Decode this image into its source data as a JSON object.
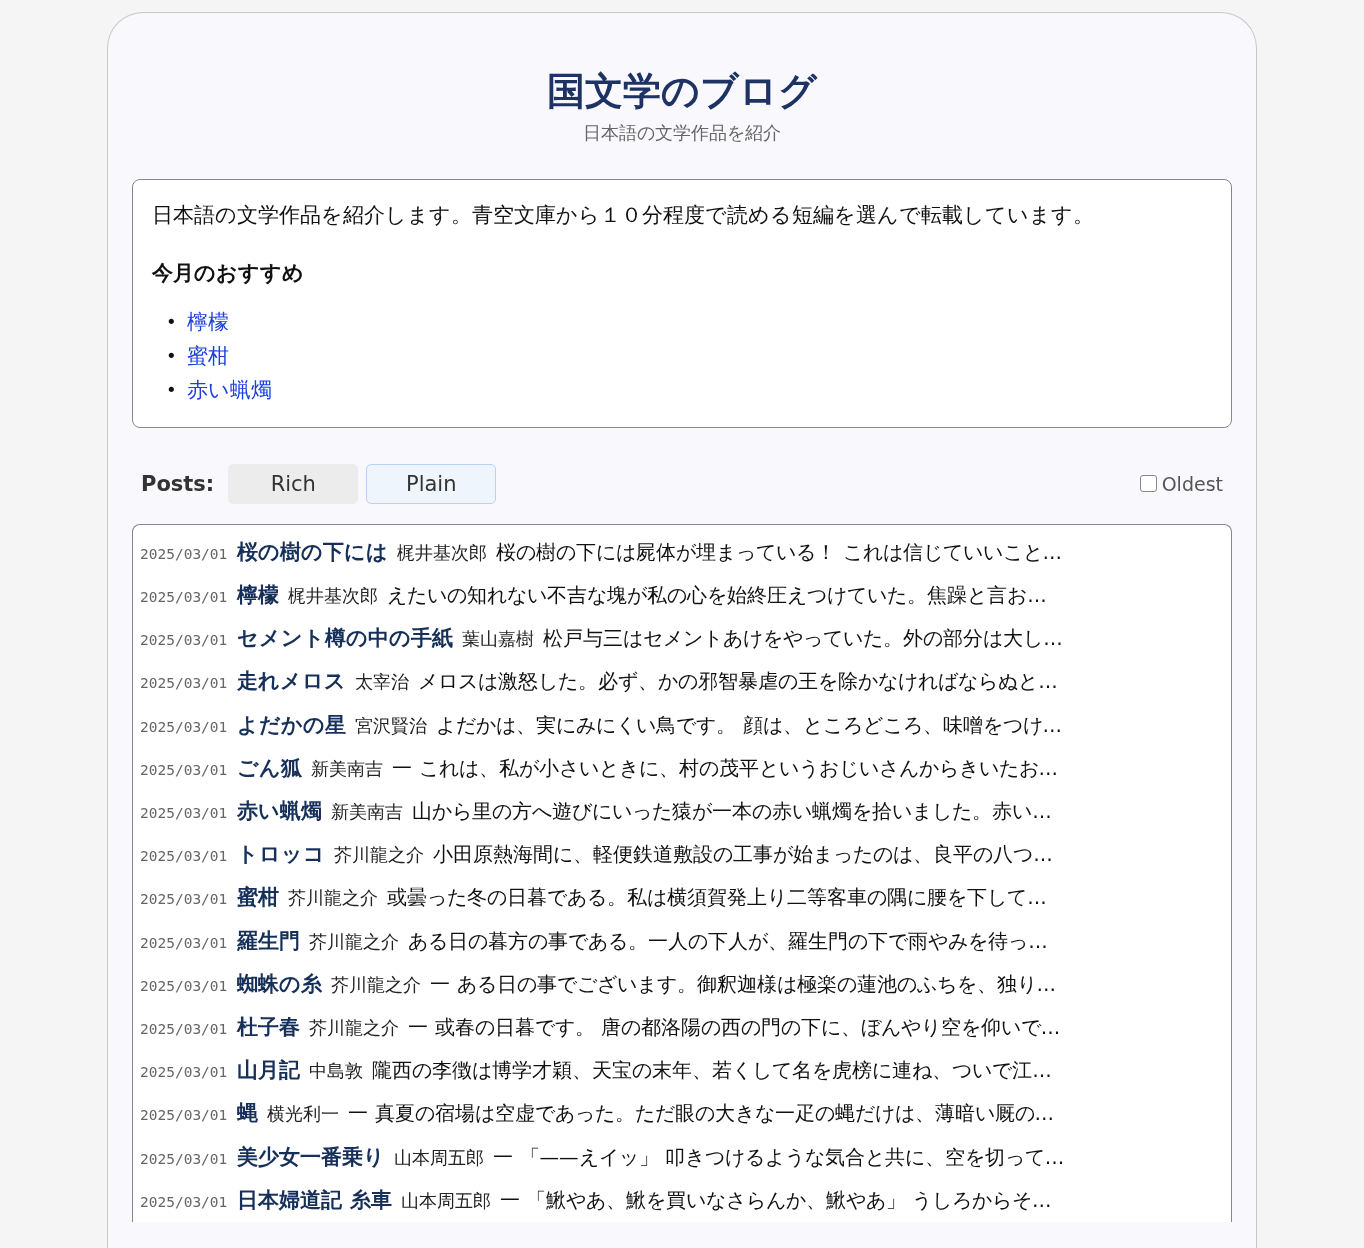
{
  "header": {
    "title": "国文学のブログ",
    "subtitle": "日本語の文学作品を紹介"
  },
  "intro": {
    "text": "日本語の文学作品を紹介します。青空文庫から１０分程度で読める短編を選んで転載しています。",
    "heading": "今月のおすすめ",
    "links": [
      {
        "marker": "•",
        "label": "檸檬"
      },
      {
        "marker": "•",
        "label": "蜜柑"
      },
      {
        "marker": "•",
        "label": "赤い蝋燭"
      }
    ]
  },
  "posts_bar": {
    "label": "Posts:",
    "tabs": [
      {
        "label": "Rich",
        "selected": false
      },
      {
        "label": "Plain",
        "selected": true
      }
    ],
    "oldest": {
      "label": "Oldest",
      "checked": false
    }
  },
  "posts": [
    {
      "date": "2025/03/01",
      "title": "桜の樹の下には",
      "author": "梶井基次郎",
      "excerpt": "桜の樹の下には屍体が埋まっている！ これは信じていいこと…"
    },
    {
      "date": "2025/03/01",
      "title": "檸檬",
      "author": "梶井基次郎",
      "excerpt": "えたいの知れない不吉な塊が私の心を始終圧えつけていた。焦躁と言お…"
    },
    {
      "date": "2025/03/01",
      "title": "セメント樽の中の手紙",
      "author": "葉山嘉樹",
      "excerpt": "松戸与三はセメントあけをやっていた。外の部分は大し…"
    },
    {
      "date": "2025/03/01",
      "title": "走れメロス",
      "author": "太宰治",
      "excerpt": "メロスは激怒した。必ず、かの邪智暴虐の王を除かなければならぬと…"
    },
    {
      "date": "2025/03/01",
      "title": "よだかの星",
      "author": "宮沢賢治",
      "excerpt": "よだかは、実にみにくい鳥です。 顔は、ところどころ、味噌をつけ…"
    },
    {
      "date": "2025/03/01",
      "title": "ごん狐",
      "author": "新美南吉",
      "excerpt": "一 これは、私が小さいときに、村の茂平というおじいさんからきいたお…"
    },
    {
      "date": "2025/03/01",
      "title": "赤い蝋燭",
      "author": "新美南吉",
      "excerpt": "山から里の方へ遊びにいった猿が一本の赤い蝋燭を拾いました。赤い…"
    },
    {
      "date": "2025/03/01",
      "title": "トロッコ",
      "author": "芥川龍之介",
      "excerpt": "小田原熱海間に、軽便鉄道敷設の工事が始まったのは、良平の八つ…"
    },
    {
      "date": "2025/03/01",
      "title": "蜜柑",
      "author": "芥川龍之介",
      "excerpt": "或曇った冬の日暮である。私は横須賀発上り二等客車の隅に腰を下して…"
    },
    {
      "date": "2025/03/01",
      "title": "羅生門",
      "author": "芥川龍之介",
      "excerpt": "ある日の暮方の事である。一人の下人が、羅生門の下で雨やみを待っ…"
    },
    {
      "date": "2025/03/01",
      "title": "蜘蛛の糸",
      "author": "芥川龍之介",
      "excerpt": "一 ある日の事でございます。御釈迦様は極楽の蓮池のふちを、独り…"
    },
    {
      "date": "2025/03/01",
      "title": "杜子春",
      "author": "芥川龍之介",
      "excerpt": "一 或春の日暮です。 唐の都洛陽の西の門の下に、ぼんやり空を仰いで…"
    },
    {
      "date": "2025/03/01",
      "title": "山月記",
      "author": "中島敦",
      "excerpt": "隴西の李徴は博学才穎、天宝の末年、若くして名を虎榜に連ね、ついで江…"
    },
    {
      "date": "2025/03/01",
      "title": "蝿",
      "author": "横光利一",
      "excerpt": "一 真夏の宿場は空虚であった。ただ眼の大きな一疋の蝿だけは、薄暗い厩の…"
    },
    {
      "date": "2025/03/01",
      "title": "美少女一番乗り",
      "author": "山本周五郎",
      "excerpt": "一 「——えイッ」 叩きつけるような気合と共に、空を切って…"
    },
    {
      "date": "2025/03/01",
      "title": "日本婦道記 糸車",
      "author": "山本周五郎",
      "excerpt": "一 「鰍やあ、鰍を買いなさらんか、鰍やあ」 うしろからそ…"
    }
  ]
}
